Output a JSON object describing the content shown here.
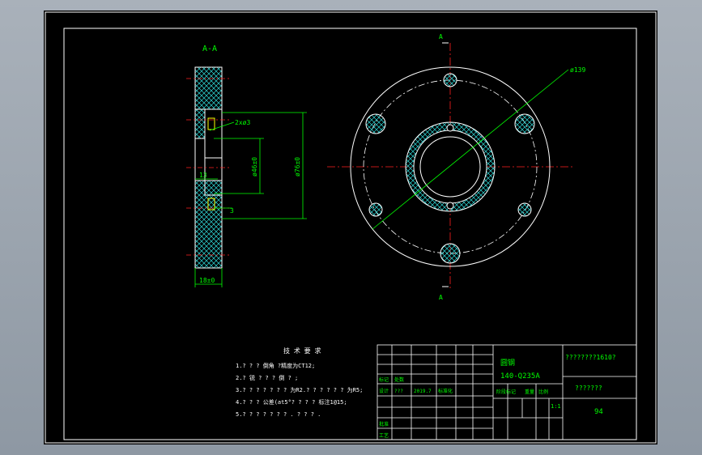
{
  "drawing": {
    "section_label": "A-A",
    "cut_label_top": "A",
    "cut_label_bottom": "A",
    "dim_outer_dia": "ø139",
    "dim_hole": "2xø3",
    "dim_inner_dia": "ø46±0",
    "dim_pitch_dia": "ø76±0",
    "dim_13": "13",
    "dim_3": "3",
    "dim_thickness": "18±0"
  },
  "tech_requirements": {
    "title": "技 术 要 求",
    "lines": [
      "1.? ? ? 倒角 ?精度为CT12;",
      "2.? 锐 ? ? ? 倒 ? ;",
      "3.? ? ? ? ? ? ? 为R2.? ? ? ? ? ? 为R5;",
      "4.? ? ? 公差(at5°? ? ? ? 标注1@15;",
      "5.? ? ? ? ? ? ? . ? ? ? ."
    ]
  },
  "title_block": {
    "part_name": "圆钢",
    "material": "140-Q235A",
    "company": "????????1610?",
    "drawing_no": "???????",
    "sheet_no": "94",
    "scale": "1:1",
    "design_label": "设计",
    "designer": "???",
    "date": "2019.7",
    "std_label": "标准化",
    "mark_label": "标记",
    "qty_label": "处数",
    "approve_label": "批准",
    "process_label": "工艺",
    "stage_label": "阶段标记",
    "weight_label": "重量",
    "ratio_label": "比例"
  }
}
